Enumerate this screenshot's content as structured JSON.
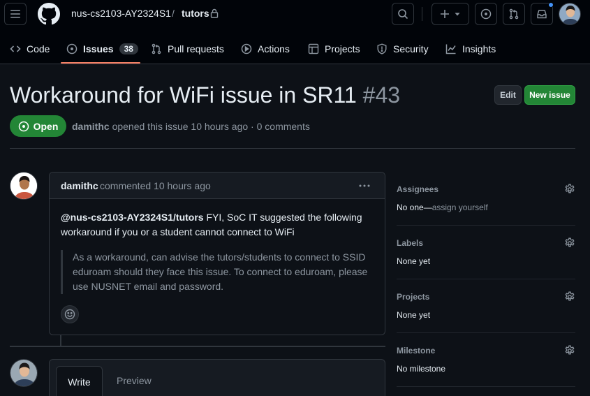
{
  "header": {
    "owner": "nus-cs2103-AY2324S1",
    "separator": "/",
    "repo": "tutors",
    "icons": [
      "hamburger-icon",
      "github-logo-icon",
      "lock-icon",
      "search-icon",
      "plus-icon",
      "chevron-down-icon",
      "issue-opened-icon",
      "pull-request-icon",
      "inbox-icon"
    ],
    "notification_color": "#4493f8"
  },
  "tabs": [
    {
      "label": "Code",
      "icon": "code-icon"
    },
    {
      "label": "Issues",
      "icon": "issue-opened-icon",
      "count": "38",
      "active": true
    },
    {
      "label": "Pull requests",
      "icon": "pull-request-icon"
    },
    {
      "label": "Actions",
      "icon": "play-icon"
    },
    {
      "label": "Projects",
      "icon": "table-icon"
    },
    {
      "label": "Security",
      "icon": "shield-icon"
    },
    {
      "label": "Insights",
      "icon": "graph-icon"
    }
  ],
  "issue": {
    "title": "Workaround for WiFi issue in SR11",
    "number": "#43",
    "state": "Open",
    "author": "damithc",
    "meta_text": "opened this issue 10 hours ago · 0 comments",
    "edit_label": "Edit",
    "new_issue_label": "New issue"
  },
  "comment": {
    "author": "damithc",
    "time": "commented 10 hours ago",
    "mention": "@nus-cs2103-AY2324S1/tutors",
    "body": " FYI, SoC IT suggested the following workaround if you or a student cannot connect to WiFi",
    "quote": "As a workaround, can advise the tutors/students to connect to SSID eduroam should they face this issue. To connect to eduroam, please use NUSNET email and password."
  },
  "composer": {
    "write_label": "Write",
    "preview_label": "Preview"
  },
  "sidebar": {
    "assignees": {
      "title": "Assignees",
      "value": "No one—",
      "link": "assign yourself"
    },
    "labels": {
      "title": "Labels",
      "value": "None yet"
    },
    "projects": {
      "title": "Projects",
      "value": "None yet"
    },
    "milestone": {
      "title": "Milestone",
      "value": "No milestone"
    }
  },
  "colors": {
    "background": "#0d1117",
    "open_green": "#238636",
    "tab_accent": "#f78166",
    "border": "#30363d",
    "muted_text": "#8d96a0"
  }
}
